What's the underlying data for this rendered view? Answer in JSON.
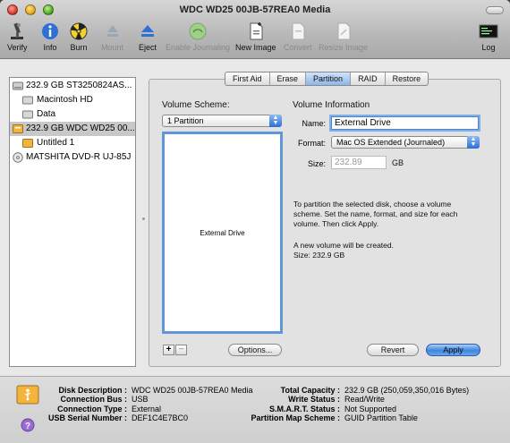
{
  "window": {
    "title": "WDC WD25 00JB-57REA0 Media"
  },
  "toolbar": {
    "items": [
      {
        "label": "Verify",
        "icon": "microscope-icon"
      },
      {
        "label": "Info",
        "icon": "info-icon"
      },
      {
        "label": "Burn",
        "icon": "burn-icon"
      },
      {
        "label": "Mount",
        "icon": "mount-icon"
      },
      {
        "label": "Eject",
        "icon": "eject-icon"
      },
      {
        "label": "Enable Journaling",
        "icon": "journaling-icon"
      },
      {
        "label": "New Image",
        "icon": "new-image-icon"
      },
      {
        "label": "Convert",
        "icon": "convert-icon"
      },
      {
        "label": "Resize Image",
        "icon": "resize-image-icon"
      },
      {
        "label": "Log",
        "icon": "log-icon"
      }
    ]
  },
  "sidebar": {
    "items": [
      {
        "label": "232.9 GB ST3250824AS..."
      },
      {
        "label": "Macintosh HD"
      },
      {
        "label": "Data"
      },
      {
        "label": "232.9 GB WDC WD25 00..."
      },
      {
        "label": "Untitled 1"
      },
      {
        "label": "MATSHITA DVD-R UJ-85J"
      }
    ]
  },
  "tabs": [
    "First Aid",
    "Erase",
    "Partition",
    "RAID",
    "Restore"
  ],
  "partition": {
    "volume_scheme_label": "Volume Scheme:",
    "scheme_value": "1 Partition",
    "partition_name": "External Drive",
    "volume_info_label": "Volume Information",
    "name_label": "Name:",
    "name_value": "External Drive",
    "format_label": "Format:",
    "format_value": "Mac OS Extended (Journaled)",
    "size_label": "Size:",
    "size_value": "232.89",
    "size_unit": "GB",
    "instructions": "To partition the selected disk, choose a volume scheme. Set the name, format, and size for each volume. Then click Apply.",
    "status_line1": "A new volume will be created.",
    "status_line2": "Size: 232.9 GB",
    "add_label": "+",
    "remove_label": "−",
    "options_label": "Options...",
    "revert_label": "Revert",
    "apply_label": "Apply"
  },
  "infobar": {
    "disk_description_key": "Disk Description :",
    "disk_description_val": "WDC WD25 00JB-57REA0 Media",
    "connection_bus_key": "Connection Bus :",
    "connection_bus_val": "USB",
    "connection_type_key": "Connection Type :",
    "connection_type_val": "External",
    "usb_serial_key": "USB Serial Number :",
    "usb_serial_val": "DEF1C4E7BC0",
    "total_capacity_key": "Total Capacity :",
    "total_capacity_val": "232.9 GB (250,059,350,016 Bytes)",
    "write_status_key": "Write Status :",
    "write_status_val": "Read/Write",
    "smart_key": "S.M.A.R.T. Status :",
    "smart_val": "Not Supported",
    "pmap_key": "Partition Map Scheme :",
    "pmap_val": "GUID Partition Table"
  },
  "colors": {
    "accent": "#3f84dd",
    "selection": "#c8c8c8"
  }
}
